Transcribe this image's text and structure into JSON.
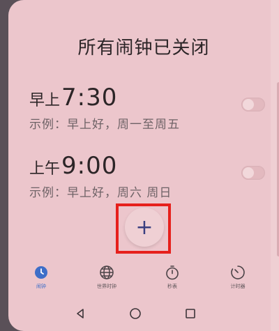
{
  "header": {
    "title": "所有闹钟已关闭"
  },
  "alarms": [
    {
      "period": "早上",
      "time": "7:30",
      "description": "示例：早上好，周一至周五",
      "enabled": false
    },
    {
      "period": "上午",
      "time": "9:00",
      "description": "示例：早上好，周六 周日",
      "enabled": false
    }
  ],
  "add_button": {
    "label": "+"
  },
  "tabs": [
    {
      "label": "闹钟",
      "icon": "alarm-clock-icon",
      "active": true
    },
    {
      "label": "世界时钟",
      "icon": "globe-icon",
      "active": false
    },
    {
      "label": "秒表",
      "icon": "stopwatch-icon",
      "active": false
    },
    {
      "label": "计时器",
      "icon": "timer-icon",
      "active": false
    }
  ],
  "colors": {
    "accent": "#3e6ec8",
    "background": "#ecc6cc",
    "highlight": "#e6201c",
    "add_icon": "#3a3f80"
  }
}
